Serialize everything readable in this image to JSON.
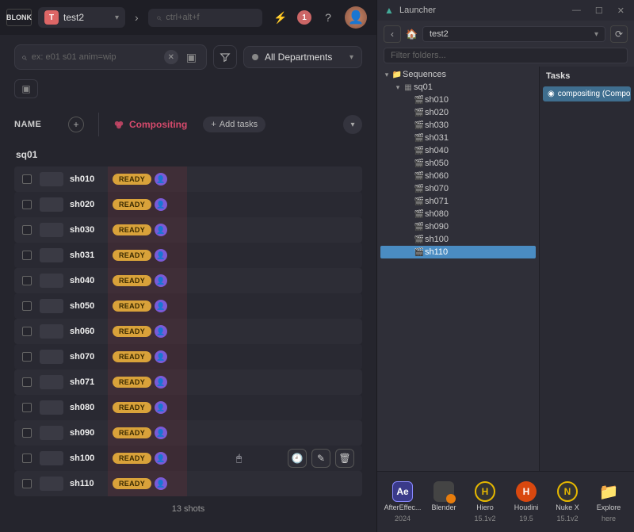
{
  "header": {
    "logo_text": "BLONK",
    "project_initial": "T",
    "project_name": "test2",
    "search_placeholder": "ctrl+alt+f",
    "notification_count": "1"
  },
  "filter": {
    "placeholder": "ex: e01 s01 anim=wip",
    "department_label": "All Departments"
  },
  "table": {
    "name_header": "NAME",
    "column_label": "Compositing",
    "add_tasks_label": "Add tasks",
    "sequence": "sq01",
    "footer": "13 shots",
    "shots": [
      {
        "name": "sh010",
        "status": "READY"
      },
      {
        "name": "sh020",
        "status": "READY"
      },
      {
        "name": "sh030",
        "status": "READY"
      },
      {
        "name": "sh031",
        "status": "READY"
      },
      {
        "name": "sh040",
        "status": "READY"
      },
      {
        "name": "sh050",
        "status": "READY"
      },
      {
        "name": "sh060",
        "status": "READY"
      },
      {
        "name": "sh070",
        "status": "READY"
      },
      {
        "name": "sh071",
        "status": "READY"
      },
      {
        "name": "sh080",
        "status": "READY"
      },
      {
        "name": "sh090",
        "status": "READY"
      },
      {
        "name": "sh100",
        "status": "READY",
        "actions": true
      },
      {
        "name": "sh110",
        "status": "READY"
      }
    ]
  },
  "launcher": {
    "title": "Launcher",
    "breadcrumb": "test2",
    "filter_placeholder": "Filter folders...",
    "tasks_header": "Tasks",
    "task_item": "compositing (Composi...",
    "tree": [
      {
        "level": 0,
        "expanded": true,
        "icon": "folder",
        "label": "Sequences"
      },
      {
        "level": 1,
        "expanded": true,
        "icon": "grid",
        "label": "sq01"
      },
      {
        "level": 2,
        "icon": "clap",
        "label": "sh010"
      },
      {
        "level": 2,
        "icon": "clap",
        "label": "sh020"
      },
      {
        "level": 2,
        "icon": "clap",
        "label": "sh030"
      },
      {
        "level": 2,
        "icon": "clap",
        "label": "sh031"
      },
      {
        "level": 2,
        "icon": "clap",
        "label": "sh040"
      },
      {
        "level": 2,
        "icon": "clap",
        "label": "sh050"
      },
      {
        "level": 2,
        "icon": "clap",
        "label": "sh060"
      },
      {
        "level": 2,
        "icon": "clap",
        "label": "sh070"
      },
      {
        "level": 2,
        "icon": "clap",
        "label": "sh071"
      },
      {
        "level": 2,
        "icon": "clap",
        "label": "sh080"
      },
      {
        "level": 2,
        "icon": "clap",
        "label": "sh090"
      },
      {
        "level": 2,
        "icon": "clap",
        "label": "sh100"
      },
      {
        "level": 2,
        "icon": "clap",
        "label": "sh110",
        "selected": true
      }
    ],
    "apps": [
      {
        "short": "Ae",
        "cls": "ae-icon",
        "name": "AfterEffec...",
        "ver": "2024"
      },
      {
        "short": "",
        "cls": "bl-icon",
        "name": "Blender",
        "ver": ""
      },
      {
        "short": "H",
        "cls": "hi-icon",
        "name": "Hiero",
        "ver": "15.1v2"
      },
      {
        "short": "H",
        "cls": "ho-icon",
        "name": "Houdini",
        "ver": "19.5"
      },
      {
        "short": "N",
        "cls": "nx-icon",
        "name": "Nuke X",
        "ver": "15.1v2"
      },
      {
        "short": "📁",
        "cls": "ex-icon",
        "name": "Explore",
        "ver": "here"
      }
    ]
  }
}
